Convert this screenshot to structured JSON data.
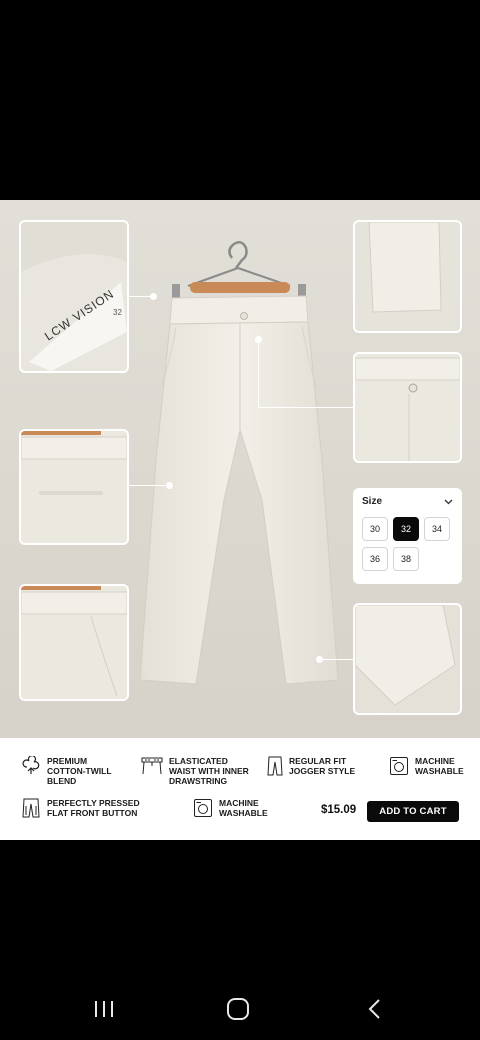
{
  "label": {
    "brand": "LCW VISION",
    "size_tag": "32"
  },
  "size_selector": {
    "title": "Size",
    "options": [
      "30",
      "32",
      "34",
      "36",
      "38"
    ],
    "selected": "32"
  },
  "features": [
    {
      "icon": "cotton-icon",
      "line1": "PREMIUM",
      "line2": "COTTON-TWILL",
      "line3": "BLEND"
    },
    {
      "icon": "waistband-icon",
      "line1": "ELASTICATED",
      "line2": "WAIST WITH INNER",
      "line3": "DRAWSTRING"
    },
    {
      "icon": "trousers-icon",
      "line1": "REGULAR FIT",
      "line2": "JOGGER STYLE",
      "line3": ""
    },
    {
      "icon": "washing-machine-icon",
      "line1": "MACHINE",
      "line2": "WASHABLE",
      "line3": ""
    },
    {
      "icon": "pressed-trousers-icon",
      "line1": "PERFECTLY PRESSED",
      "line2": "FLAT FRONT BUTTON",
      "line3": ""
    },
    {
      "icon": "washing-machine-icon",
      "line1": "MACHINE",
      "line2": "WASHABLE",
      "line3": ""
    }
  ],
  "purchase": {
    "price": "$15.09",
    "cta": "ADD TO CART"
  },
  "colors": {
    "background": "#000000",
    "product_bg": "#dedad3",
    "garment": "#efece4",
    "accent": "#0a0a0a"
  },
  "navbar": {
    "icons": [
      "recent-apps-icon",
      "home-icon",
      "back-icon"
    ]
  }
}
